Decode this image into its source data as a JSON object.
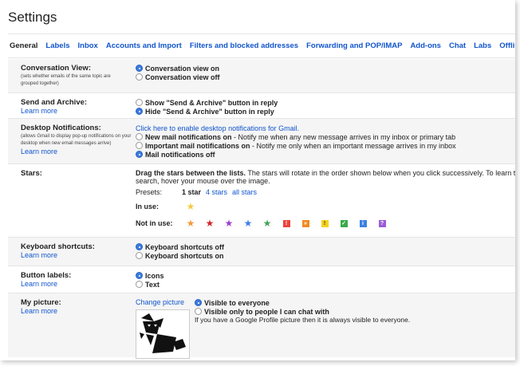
{
  "header": {
    "title": "Settings"
  },
  "tabs": [
    "General",
    "Labels",
    "Inbox",
    "Accounts and Import",
    "Filters and blocked addresses",
    "Forwarding and POP/IMAP",
    "Add-ons",
    "Chat",
    "Labs",
    "Offline"
  ],
  "conversation_view": {
    "name": "Conversation View:",
    "desc": "(sets whether emails of the same topic are grouped together)",
    "opt_on": "Conversation view on",
    "opt_off": "Conversation view off"
  },
  "send_archive": {
    "name": "Send and Archive:",
    "learn": "Learn more",
    "opt_show": "Show \"Send & Archive\" button in reply",
    "opt_hide": "Hide \"Send & Archive\" button in reply"
  },
  "desktop_notifications": {
    "name": "Desktop Notifications:",
    "desc": "(allows Gmail to display pop-up notifications on your desktop when new email messages arrive)",
    "learn": "Learn more",
    "enable_link": "Click here to enable desktop notifications for Gmail.",
    "new_mail_bold": "New mail notifications on",
    "new_mail_rest": " - Notify me when any new message arrives in my inbox or primary tab",
    "important_bold": "Important mail notifications on",
    "important_rest": " - Notify me only when an important message arrives in my inbox",
    "off": "Mail notifications off"
  },
  "stars": {
    "name": "Stars:",
    "intro_bold": "Drag the stars between the lists.",
    "intro_rest": "  The stars will rotate in the order shown below when you click successively. To learn the",
    "intro_line2": "search, hover your mouse over the image.",
    "presets_label": "Presets:",
    "preset_1": "1 star",
    "preset_4": "4 stars",
    "preset_all": "all stars",
    "in_use_label": "In use:",
    "not_in_use_label": "Not in use:",
    "colors": {
      "in_use_star": "#f7c948",
      "orange_star": "#f29b38",
      "red_star": "#d6252b",
      "purple_star": "#9b3fd1",
      "blue_star": "#3f7ee8",
      "green_star": "#41a55a",
      "red_bang": "#e8453c",
      "orange_guillemet": "#f08b24",
      "yellow_bang": "#f5d21a",
      "green_check": "#3aa94a",
      "blue_info": "#3b82e0",
      "purple_question": "#9b5cd6"
    }
  },
  "keyboard": {
    "name": "Keyboard shortcuts:",
    "learn": "Learn more",
    "opt_off": "Keyboard shortcuts off",
    "opt_on": "Keyboard shortcuts on"
  },
  "button_labels": {
    "name": "Button labels:",
    "learn": "Learn more",
    "opt_icons": "Icons",
    "opt_text": "Text"
  },
  "my_picture": {
    "name": "My picture:",
    "learn": "Learn more",
    "change_link": "Change picture",
    "visible_all": "Visible to everyone",
    "visible_chat": "Visible only to people I can chat with",
    "note": "If you have a Google Profile picture then it is always visible to everyone."
  }
}
